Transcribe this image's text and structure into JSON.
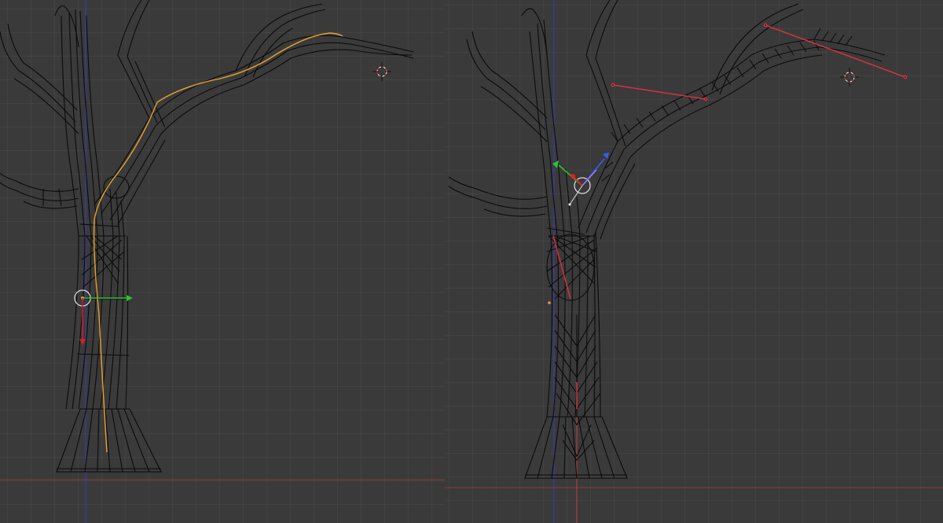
{
  "viewports": [
    {
      "id": "left",
      "description_hidden": ""
    },
    {
      "id": "right",
      "description_hidden": ""
    }
  ],
  "colors": {
    "background": "#393939",
    "grid": "#454545",
    "wire": "#0a0a0a",
    "axis_x": "#a83a3a",
    "axis_y_blue": "#3a3ad0",
    "curve_selected": "#f0a030",
    "gizmo_x": "#e02020",
    "gizmo_y": "#30c030",
    "gizmo_z": "#3060ff",
    "edge_selected": "#e03040",
    "cursor_outer": "#ffffff",
    "cursor_inner": "#e04040"
  },
  "icons": {
    "cursor3d": "3d-cursor-icon",
    "gizmo": "transform-gizmo-icon",
    "origin": "object-origin-icon"
  }
}
